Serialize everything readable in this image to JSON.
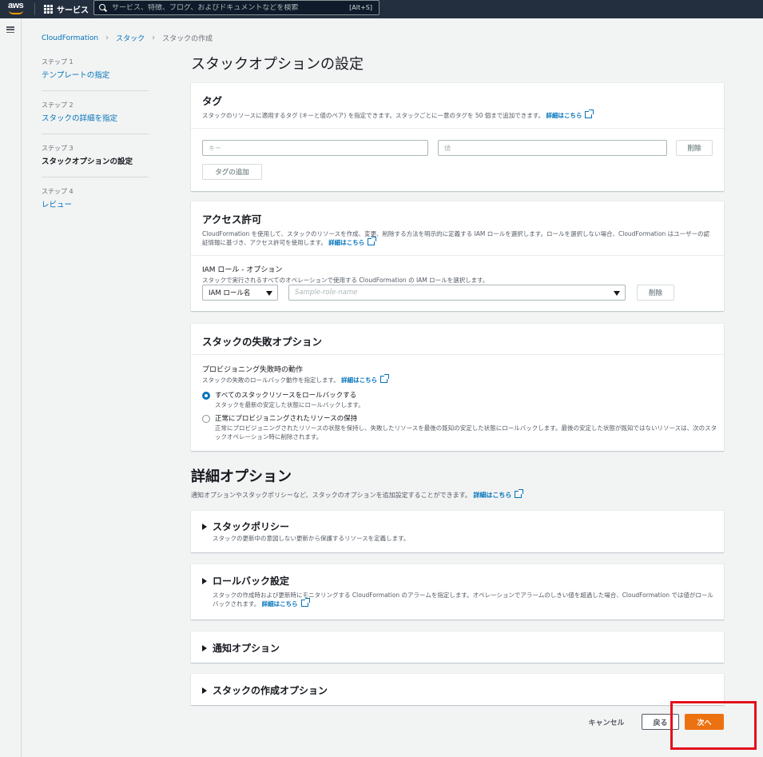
{
  "topnav": {
    "logo": "aws",
    "services_label": "サービス",
    "search_placeholder": "サービス、特徴、ブログ、およびドキュメントなどを検索",
    "shortcut": "[Alt+S]"
  },
  "breadcrumb": [
    "CloudFormation",
    "スタック",
    "スタックの作成"
  ],
  "steps": [
    {
      "num": "ステップ 1",
      "label": "テンプレートの指定"
    },
    {
      "num": "ステップ 2",
      "label": "スタックの詳細を指定"
    },
    {
      "num": "ステップ 3",
      "label": "スタックオプションの設定"
    },
    {
      "num": "ステップ 4",
      "label": "レビュー"
    }
  ],
  "page_title": "スタックオプションの設定",
  "tags": {
    "title": "タグ",
    "desc": "スタックのリソースに適用するタグ (キーと値のペア) を指定できます。スタックごとに一意のタグを 50 個まで追加できます。",
    "learn_more": "詳細はこちら",
    "key_placeholder": "キー",
    "value_placeholder": "値",
    "remove_label": "削除",
    "add_label": "タグの追加"
  },
  "permissions": {
    "title": "アクセス許可",
    "desc": "CloudFormation を使用して、スタックのリソースを作成、変更、削除する方法を明示的に定義する IAM ロールを選択します。ロールを選択しない場合、CloudFormation はユーザーの認証情報に基づき、アクセス許可を使用します。",
    "learn_more": "詳細はこちら",
    "field_label": "IAM ロール - オプション",
    "field_desc": "スタックで実行されるすべてのオペレーションで使用する CloudFormation の IAM ロールを選択します。",
    "select_type": "IAM ロール名",
    "role_placeholder": "Sample-role-name",
    "remove_label": "削除"
  },
  "failure": {
    "title": "スタックの失敗オプション",
    "field_label": "プロビジョニング失敗時の動作",
    "field_desc": "スタックの失敗のロールバック動作を指定します。",
    "learn_more": "詳細はこちら",
    "option1_label": "すべてのスタックリソースをロールバックする",
    "option1_desc": "スタックを最新の安定した状態にロールバックします。",
    "option2_label": "正常にプロビジョニングされたリソースの保持",
    "option2_desc": "正常にプロビジョニングされたリソースの状態を保持し、失敗したリソースを最後の既知の安定した状態にロールバックします。最後の安定した状態が既知ではないリソースは、次のスタックオペレーション時に削除されます。"
  },
  "advanced": {
    "title": "詳細オプション",
    "desc": "通知オプションやスタックポリシーなど、スタックのオプションを追加設定することができます。",
    "learn_more": "詳細はこちら",
    "policy_title": "スタックポリシー",
    "policy_desc": "スタックの更新中の意図しない更新から保護するリソースを定義します。",
    "rollback_title": "ロールバック設定",
    "rollback_desc": "スタックの作成時および更新時にモニタリングする CloudFormation のアラームを指定します。オペレーションでアラームのしきい値を超過した場合、CloudFormation では値がロールバックされます。",
    "rollback_learn_more": "詳細はこちら",
    "notify_title": "通知オプション",
    "create_title": "スタックの作成オプション"
  },
  "footer": {
    "cancel": "キャンセル",
    "back": "戻る",
    "next": "次へ"
  }
}
